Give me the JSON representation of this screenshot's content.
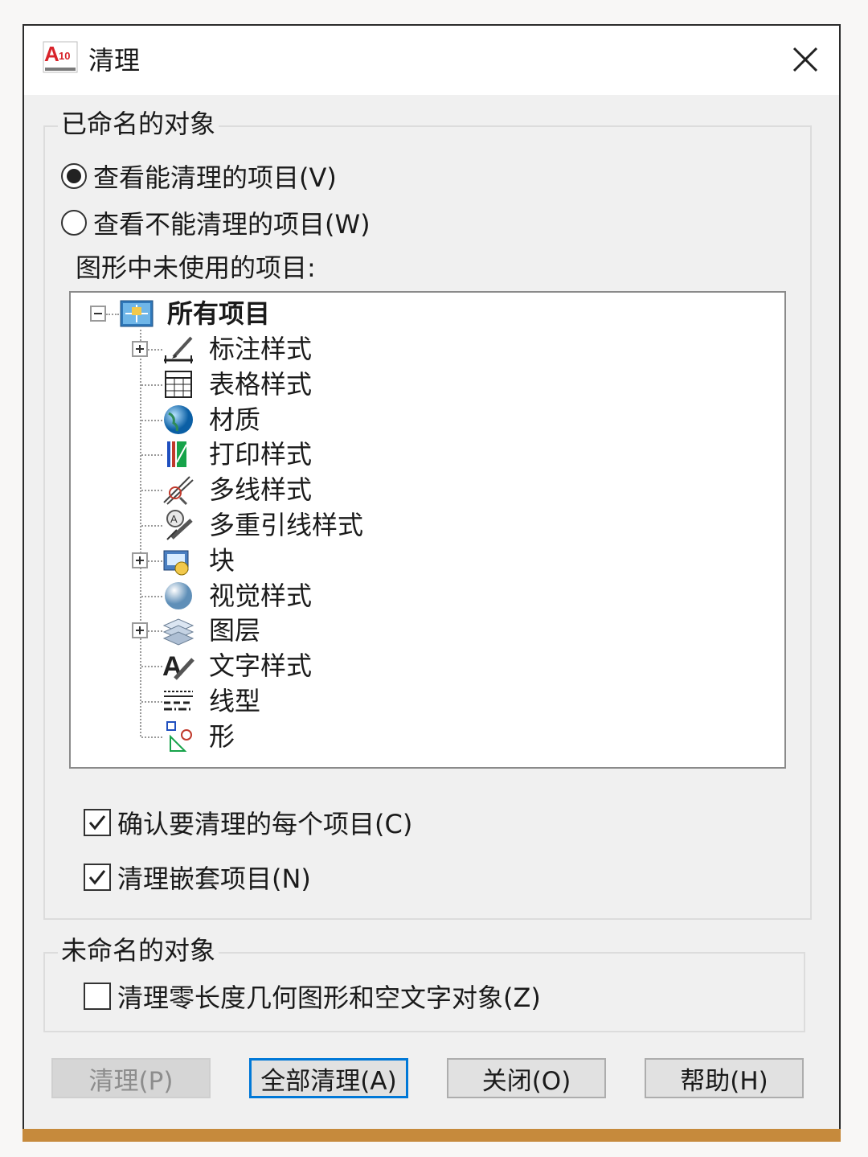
{
  "window": {
    "title": "清理",
    "app_icon_text": "A10"
  },
  "named": {
    "group_title": "已命名的对象",
    "radio_purgeable": "查看能清理的项目(V)",
    "radio_nonpurgeable": "查看不能清理的项目(W)",
    "selected_radio": "purgeable",
    "tree_caption": "图形中未使用的项目:",
    "tree": {
      "root": "所有项目",
      "items": [
        {
          "label": "标注样式",
          "icon": "dimension-style-icon",
          "expandable": true
        },
        {
          "label": "表格样式",
          "icon": "table-style-icon",
          "expandable": false
        },
        {
          "label": "材质",
          "icon": "material-globe-icon",
          "expandable": false
        },
        {
          "label": "打印样式",
          "icon": "plot-style-icon",
          "expandable": false
        },
        {
          "label": "多线样式",
          "icon": "multiline-style-icon",
          "expandable": false
        },
        {
          "label": "多重引线样式",
          "icon": "multileader-style-icon",
          "expandable": false
        },
        {
          "label": "块",
          "icon": "block-icon",
          "expandable": true
        },
        {
          "label": "视觉样式",
          "icon": "visual-style-sphere-icon",
          "expandable": false
        },
        {
          "label": "图层",
          "icon": "layers-icon",
          "expandable": true
        },
        {
          "label": "文字样式",
          "icon": "text-style-icon",
          "expandable": false
        },
        {
          "label": "线型",
          "icon": "linetype-icon",
          "expandable": false
        },
        {
          "label": "形",
          "icon": "shape-icon",
          "expandable": false
        }
      ]
    },
    "check_confirm": "确认要清理的每个项目(C)",
    "check_confirm_checked": true,
    "check_nested": "清理嵌套项目(N)",
    "check_nested_checked": true
  },
  "unnamed": {
    "group_title": "未命名的对象",
    "check_zero_length": "清理零长度几何图形和空文字对象(Z)",
    "check_zero_length_checked": false
  },
  "buttons": {
    "purge": "清理(P)",
    "purge_all": "全部清理(A)",
    "close": "关闭(O)",
    "help": "帮助(H)"
  },
  "colors": {
    "accent": "#0078d7",
    "dialog_bg": "#f0f0f0",
    "bottom_bar": "#c68a3c"
  }
}
